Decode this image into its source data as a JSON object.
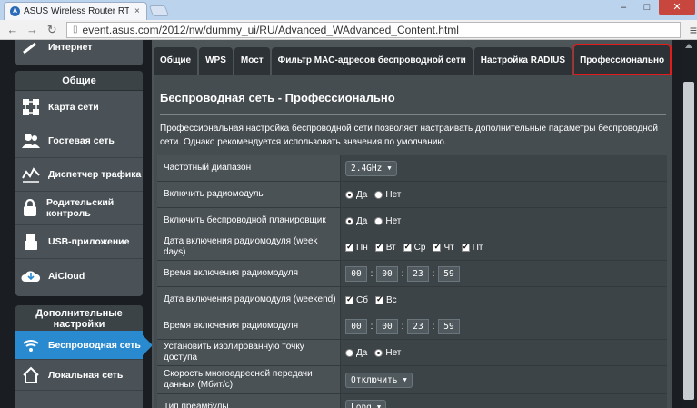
{
  "browser": {
    "tab_title": "ASUS Wireless Router RT-",
    "tab_close": "×",
    "url": "event.asus.com/2012/nw/dummy_ui/RU/Advanced_WAdvanced_Content.html",
    "win_min": "–",
    "win_max": "□",
    "win_close": "✕"
  },
  "sidebar": {
    "top_item": "Интернет",
    "general_header": "Общие",
    "items": [
      {
        "label": "Карта сети",
        "icon": "network-map-icon"
      },
      {
        "label": "Гостевая сеть",
        "icon": "guest-network-icon"
      },
      {
        "label": "Диспетчер трафика",
        "icon": "traffic-manager-icon"
      },
      {
        "label": "Родительский контроль",
        "icon": "parental-control-icon"
      },
      {
        "label": "USB-приложение",
        "icon": "usb-icon"
      },
      {
        "label": "AiCloud",
        "icon": "cloud-icon"
      }
    ],
    "advanced_header": "Дополнительные настройки",
    "advanced_items": [
      {
        "label": "Беспроводная сеть",
        "icon": "wifi-icon",
        "active": true
      },
      {
        "label": "Локальная сеть",
        "icon": "home-icon"
      }
    ]
  },
  "tabs": [
    {
      "label": "Общие"
    },
    {
      "label": "WPS"
    },
    {
      "label": "Мост"
    },
    {
      "label": "Фильтр MAC-адресов беспроводной сети"
    },
    {
      "label": "Настройка RADIUS"
    },
    {
      "label": "Профессионально",
      "active": true
    }
  ],
  "panel": {
    "title": "Беспроводная сеть - Профессионально",
    "description": "Профессиональная настройка беспроводной сети позволяет настраивать дополнительные параметры беспроводной сети. Однако рекомендуется использовать значения по умолчанию."
  },
  "settings": {
    "band": {
      "label": "Частотный диапазон",
      "value": "2.4GHz"
    },
    "radio_enable": {
      "label": "Включить радиомодуль",
      "yes": "Да",
      "no": "Нет",
      "selected": "yes"
    },
    "scheduler": {
      "label": "Включить беспроводной планировщик",
      "yes": "Да",
      "no": "Нет",
      "selected": "yes"
    },
    "weekdays": {
      "label": "Дата включения радиомодуля (week days)",
      "days": [
        {
          "label": "Пн",
          "checked": true
        },
        {
          "label": "Вт",
          "checked": true
        },
        {
          "label": "Ср",
          "checked": true
        },
        {
          "label": "Чт",
          "checked": true
        },
        {
          "label": "Пт",
          "checked": true
        }
      ]
    },
    "weekday_time": {
      "label": "Время включения радиомодуля",
      "h1": "00",
      "m1": "00",
      "h2": "23",
      "m2": "59",
      "sep": ":"
    },
    "weekend": {
      "label": "Дата включения радиомодуля (weekend)",
      "days": [
        {
          "label": "Сб",
          "checked": true
        },
        {
          "label": "Вс",
          "checked": true
        }
      ]
    },
    "weekend_time": {
      "label": "Время включения радиомодуля",
      "h1": "00",
      "m1": "00",
      "h2": "23",
      "m2": "59",
      "sep": ":"
    },
    "ap_isolation": {
      "label": "Установить изолированную точку доступа",
      "yes": "Да",
      "no": "Нет",
      "selected": "no"
    },
    "multicast_rate": {
      "label": "Скорость многоадресной передачи данных (Мбит/с)",
      "value": "Отключить"
    },
    "preamble": {
      "label": "Тип преамбулы",
      "value": "Long"
    }
  },
  "colors": {
    "accent_blue": "#2a8ad0",
    "active_tab_outline": "#e21b1b"
  }
}
